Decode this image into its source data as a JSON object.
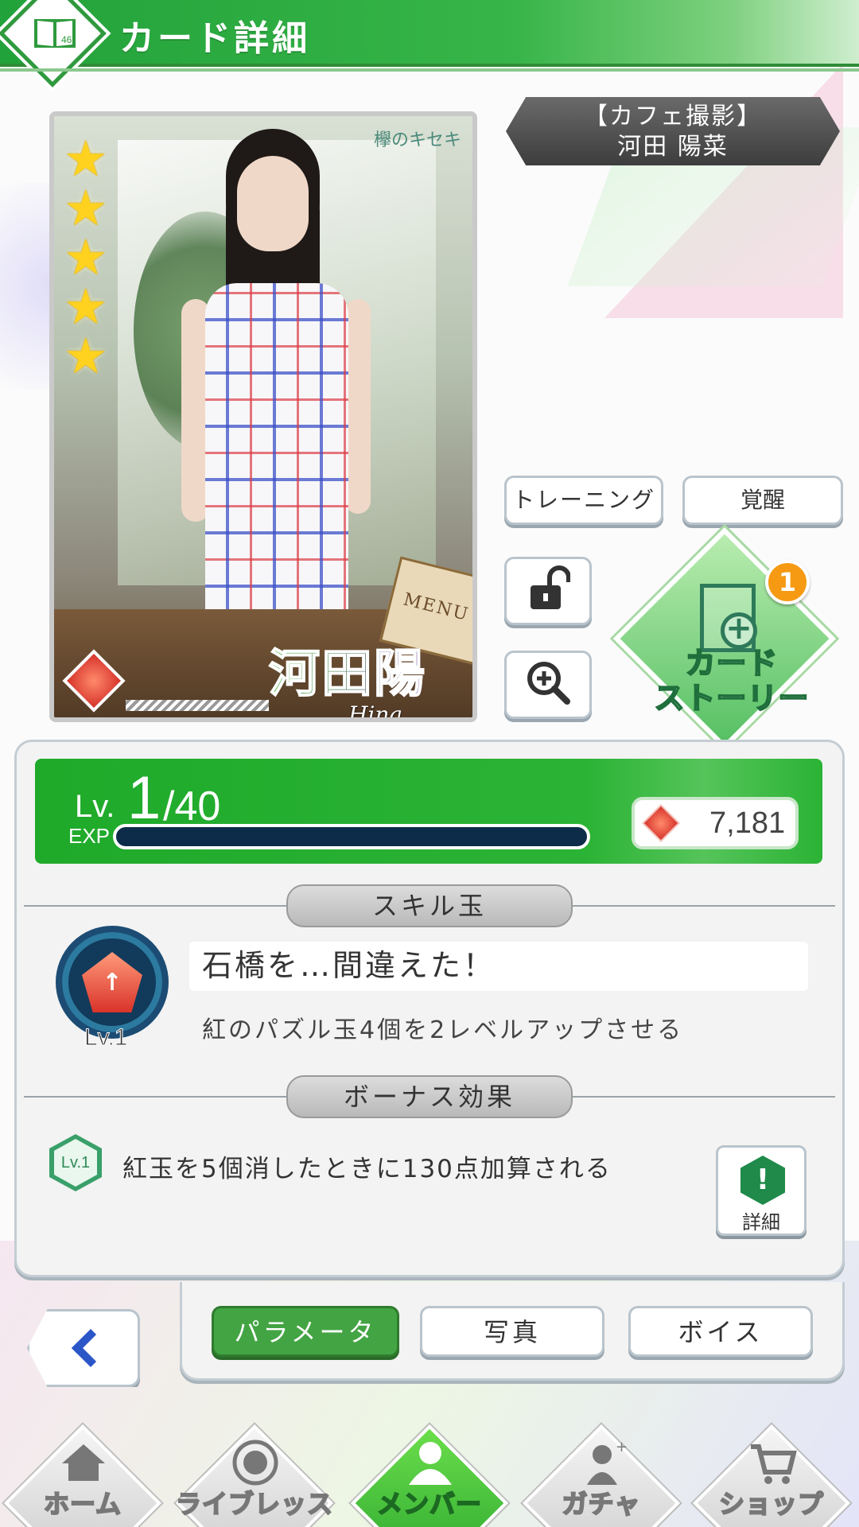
{
  "header": {
    "title": "カード詳細",
    "badge_text": "46"
  },
  "card": {
    "banner_line1": "【カフェ撮影】",
    "banner_line2": "河田 陽菜",
    "name_jp": "河田陽菜",
    "name_en": "Hina Kawata",
    "art_logo": "欅のキセキ",
    "menu_sign": "MENU",
    "rarity_stars": 5
  },
  "actions": {
    "training_label": "トレーニング",
    "awaken_label": "覚醒",
    "story_label_line1": "カード",
    "story_label_line2": "ストーリー",
    "story_badge": "1"
  },
  "level": {
    "lv_prefix": "Lv.",
    "current": "1",
    "max": "/40",
    "exp_label": "EXP",
    "exp_fraction": 0,
    "gems": "7,181"
  },
  "skill": {
    "section_title": "スキル玉",
    "name": "石橋を…間違えた！",
    "description": "紅のパズル玉4個を2レベルアップさせる",
    "level": "Lv.1"
  },
  "bonus": {
    "section_title": "ボーナス効果",
    "level": "Lv.1",
    "description": "紅玉を5個消したときに130点加算される",
    "detail_label": "詳細"
  },
  "tabs": {
    "params": "パラメータ",
    "photo": "写真",
    "voice": "ボイス"
  },
  "nav": {
    "home": "ホーム",
    "live_lesson": "ライブレッスン",
    "member": "メンバー",
    "gacha": "ガチャ",
    "shop": "ショップ"
  },
  "colors": {
    "primary_green": "#2bb335",
    "accent_orange": "#f59a12",
    "exp_bar": "#0d2c4a"
  }
}
